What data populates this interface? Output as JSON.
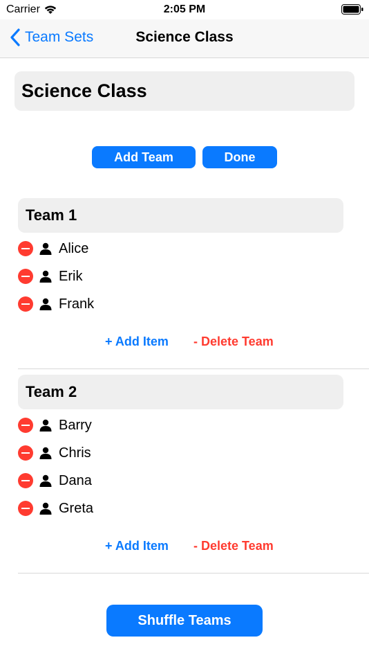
{
  "status_bar": {
    "carrier": "Carrier",
    "time": "2:05 PM",
    "icons": [
      "wifi-icon",
      "battery-icon"
    ]
  },
  "nav": {
    "back_label": "Team Sets",
    "title": "Science Class"
  },
  "set_name_field": {
    "value": "Science Class"
  },
  "buttons": {
    "add_team": "Add Team",
    "done": "Done",
    "shuffle": "Shuffle Teams"
  },
  "teams": [
    {
      "name": "Team 1",
      "members": [
        "Alice",
        "Erik",
        "Frank"
      ],
      "add_item_label": "+ Add Item",
      "delete_team_label": "- Delete Team"
    },
    {
      "name": "Team 2",
      "members": [
        "Barry",
        "Chris",
        "Dana",
        "Greta"
      ],
      "add_item_label": "+ Add Item",
      "delete_team_label": "- Delete Team"
    }
  ],
  "colors": {
    "accent": "#0a7aff",
    "destructive": "#ff3b30",
    "field_background": "#efefef"
  }
}
